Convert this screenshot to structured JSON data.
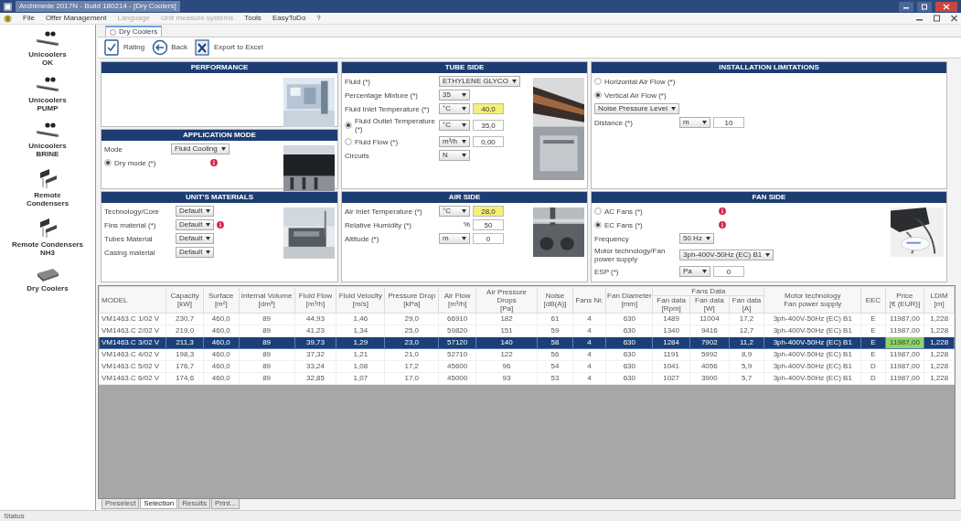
{
  "window": {
    "title": "Archimede 2017N - Build 180214 - [Dry Coolers]"
  },
  "menu": [
    {
      "label": "File",
      "disabled": false
    },
    {
      "label": "Offer Management",
      "disabled": false
    },
    {
      "label": "Language",
      "disabled": true
    },
    {
      "label": "Unit measure systems",
      "disabled": true
    },
    {
      "label": "Tools",
      "disabled": false
    },
    {
      "label": "EasyToDo",
      "disabled": false
    },
    {
      "label": "?",
      "disabled": false
    }
  ],
  "sidebar": {
    "items": [
      {
        "label": "Unicoolers\nOK",
        "kind": "cooler"
      },
      {
        "label": "Unicoolers\nPUMP",
        "kind": "cooler"
      },
      {
        "label": "Unicoolers\nBRINE",
        "kind": "cooler"
      },
      {
        "label": "Remote\nCondensers",
        "kind": "condenser"
      },
      {
        "label": "Remote Condensers\nNH3",
        "kind": "condenser"
      },
      {
        "label": "Dry Coolers",
        "kind": "drycooler"
      }
    ]
  },
  "document_tab": {
    "label": "Dry Coolers"
  },
  "toolbar": [
    {
      "label": "Rating",
      "kind": "rating"
    },
    {
      "label": "Back",
      "kind": "back"
    },
    {
      "label": "Export to Excel",
      "kind": "excel"
    }
  ],
  "panel_columns": [
    [
      {
        "title": "PERFORMANCE",
        "kind": "performance"
      },
      {
        "title": "APPLICATION MODE",
        "kind": "application",
        "fields": [
          {
            "kind": "select",
            "label": "Mode",
            "value": "Fluid Cooling"
          },
          {
            "kind": "radio",
            "label": "Dry mode (*)",
            "selected": true,
            "info": true
          }
        ]
      },
      {
        "title": "UNIT'S MATERIALS",
        "kind": "materials",
        "fields": [
          {
            "kind": "select",
            "label": "Technology/Core",
            "value": "Default"
          },
          {
            "kind": "select",
            "label": "Fins material (*)",
            "value": "Default",
            "info": true
          },
          {
            "kind": "select",
            "label": "Tubes Material",
            "value": "Default"
          },
          {
            "kind": "select",
            "label": "Casing material",
            "value": "Default"
          }
        ]
      }
    ],
    [
      {
        "title": "TUBE SIDE",
        "kind": "tube",
        "fields": [
          {
            "kind": "select",
            "label": "Fluid (*)",
            "value": "ETHYLENE GLYCO"
          },
          {
            "kind": "select",
            "label": "Percentage Mixture (*)",
            "value": "35"
          },
          {
            "kind": "unit_value",
            "label": "Fluid Inlet Temperature (*)",
            "unit": "°C",
            "value": "40,0",
            "highlighted": true
          },
          {
            "kind": "radio_unit_value",
            "label": "Fluid Outlet Temperature (*)",
            "selected": true,
            "unit": "°C",
            "value": "35,0"
          },
          {
            "kind": "radio_unit_value",
            "label": "Fluid Flow (*)",
            "selected": false,
            "unit": "m³/h",
            "value": "0,00"
          },
          {
            "kind": "select",
            "label": "Circuits",
            "value": "N"
          }
        ]
      },
      {
        "title": "AIR SIDE",
        "kind": "air",
        "fields": [
          {
            "kind": "unit_value",
            "label": "Air Inlet Temperature (*)",
            "unit": "°C",
            "value": "28,0",
            "highlighted": true
          },
          {
            "kind": "text_unit_value",
            "label": "Relative Humidity (*)",
            "unit": "%",
            "value": "50"
          },
          {
            "kind": "unit_value",
            "label": "Altitude (*)",
            "unit": "m",
            "value": "0",
            "highlighted": false
          }
        ]
      }
    ],
    [
      {
        "title": "INSTALLATION LIMITATIONS",
        "kind": "installation",
        "fields": [
          {
            "kind": "radio",
            "label": "Horizontal Air Flow (*)",
            "selected": false
          },
          {
            "kind": "radio",
            "label": "Vertical Air Flow (*)",
            "selected": true
          },
          {
            "kind": "select_only",
            "value": "Noise Pressure Level"
          },
          {
            "kind": "unit_value",
            "label": "Distance (*)",
            "unit": "m",
            "value": "10",
            "highlighted": false
          }
        ]
      },
      {
        "title": "FAN SIDE",
        "kind": "fan",
        "fields": [
          {
            "kind": "radio",
            "label": "AC Fans (*)",
            "selected": false,
            "info": true
          },
          {
            "kind": "radio",
            "label": "EC Fans (*)",
            "selected": true,
            "info": true
          },
          {
            "kind": "select",
            "label": "Frequency",
            "value": "50 Hz"
          },
          {
            "kind": "select",
            "label": "Motor technology/Fan power supply",
            "value": "3ph-400V-50Hz (EC) B1"
          },
          {
            "kind": "unit_value",
            "label": "ESP (*)",
            "unit": "Pa",
            "value": "0",
            "highlighted": false
          }
        ]
      }
    ]
  ],
  "table": {
    "header_rows": [
      [
        {
          "label": "MODEL",
          "rowspan": 2
        },
        {
          "label": "Capacity\n[kW]",
          "rowspan": 2
        },
        {
          "label": "Surface\n[m²]",
          "rowspan": 2
        },
        {
          "label": "Internal Volume\n[dm³]",
          "rowspan": 2
        },
        {
          "label": "Fluid Flow\n[m³/h]",
          "rowspan": 2
        },
        {
          "label": "Fluid Velocity\n[m/s]",
          "rowspan": 2
        },
        {
          "label": "Pressure Drop\n[kPa]",
          "rowspan": 2
        },
        {
          "label": "Air Flow\n[m³/h]",
          "rowspan": 2
        },
        {
          "label": "Air Pressure Drops\n[Pa]",
          "rowspan": 2
        },
        {
          "label": "Noise\n[dB(A)]",
          "rowspan": 2
        },
        {
          "label": "Fans Nr.",
          "rowspan": 2
        },
        {
          "label": "Fan Diameter\n[mm]",
          "rowspan": 2
        },
        {
          "label": "Fans Data",
          "colspan": 3
        },
        {
          "label": "Motor technology\nFan power supply",
          "rowspan": 2
        },
        {
          "label": "EEC",
          "rowspan": 2
        },
        {
          "label": "Price\n[€ (EUR)]",
          "rowspan": 2
        },
        {
          "label": "LDIM\n[m]",
          "rowspan": 2
        }
      ],
      [
        {
          "label": "Fan data\n[Rpm]"
        },
        {
          "label": "Fan data\n[W]"
        },
        {
          "label": "Fan data\n[A]"
        }
      ]
    ],
    "rows": [
      {
        "selected": false,
        "best_price": false,
        "cells": [
          "VM1463.C 1/02 V",
          "230,7",
          "460,0",
          "89",
          "44,93",
          "1,46",
          "29,0",
          "66910",
          "182",
          "61",
          "4",
          "630",
          "1489",
          "11004",
          "17,2",
          "3ph-400V-50Hz (EC) B1",
          "E",
          "11987,00",
          "1,228"
        ]
      },
      {
        "selected": false,
        "best_price": false,
        "cells": [
          "VM1463.C 2/02 V",
          "219,0",
          "460,0",
          "89",
          "41,23",
          "1,34",
          "25,0",
          "59820",
          "151",
          "59",
          "4",
          "630",
          "1340",
          "9416",
          "12,7",
          "3ph-400V-50Hz (EC) B1",
          "E",
          "11987,00",
          "1,228"
        ]
      },
      {
        "selected": true,
        "best_price": true,
        "cells": [
          "VM1463.C 3/02 V",
          "211,3",
          "460,0",
          "89",
          "39,73",
          "1,29",
          "23,0",
          "57120",
          "140",
          "58",
          "4",
          "630",
          "1284",
          "7902",
          "11,2",
          "3ph-400V-50Hz (EC) B1",
          "E",
          "11987,00",
          "1,228"
        ]
      },
      {
        "selected": false,
        "best_price": false,
        "cells": [
          "VM1463.C 4/02 V",
          "198,3",
          "460,0",
          "89",
          "37,32",
          "1,21",
          "21,0",
          "52710",
          "122",
          "56",
          "4",
          "630",
          "1191",
          "5992",
          "8,9",
          "3ph-400V-50Hz (EC) B1",
          "E",
          "11987,00",
          "1,228"
        ]
      },
      {
        "selected": false,
        "best_price": false,
        "cells": [
          "VM1463.C 5/02 V",
          "176,7",
          "460,0",
          "89",
          "33,24",
          "1,08",
          "17,2",
          "45600",
          "96",
          "54",
          "4",
          "630",
          "1041",
          "4056",
          "5,9",
          "3ph-400V-50Hz (EC) B1",
          "D",
          "11987,00",
          "1,228"
        ]
      },
      {
        "selected": false,
        "best_price": false,
        "cells": [
          "VM1463.C 6/02 V",
          "174,6",
          "460,0",
          "89",
          "32,85",
          "1,07",
          "17,0",
          "45000",
          "93",
          "53",
          "4",
          "630",
          "1027",
          "3900",
          "5,7",
          "3ph-400V-50Hz (EC) B1",
          "D",
          "11987,00",
          "1,228"
        ]
      }
    ]
  },
  "bottom_tabs": [
    {
      "label": "Preselect",
      "selected": false
    },
    {
      "label": "Selection",
      "selected": true
    },
    {
      "label": "Results",
      "selected": false
    },
    {
      "label": "Print...",
      "selected": false
    }
  ],
  "status_bar": {
    "text": "Status"
  }
}
